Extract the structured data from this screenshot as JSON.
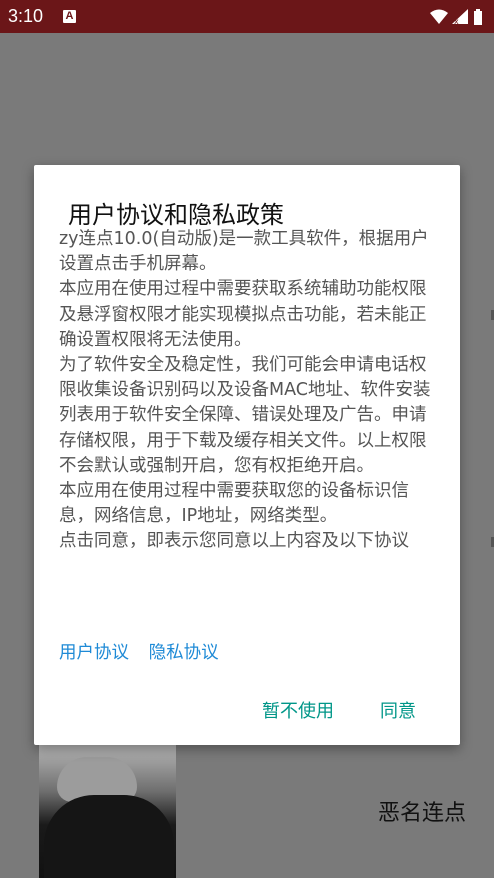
{
  "status_bar": {
    "time": "3:10",
    "app_icon_letter": "A"
  },
  "background": {
    "app_name": "恶名连点"
  },
  "dialog": {
    "title": "用户协议和隐私政策",
    "paragraphs": [
      "zy连点10.0(自动版)是一款工具软件，根据用户设置点击手机屏幕。",
      "本应用在使用过程中需要获取系统辅助功能权限及悬浮窗权限才能实现模拟点击功能，若未能正确设置权限将无法使用。",
      "为了软件安全及稳定性，我们可能会申请电话权限收集设备识别码以及设备MAC地址、软件安装列表用于软件安全保障、错误处理及广告。申请存储权限，用于下载及缓存相关文件。以上权限不会默认或强制开启，您有权拒绝开启。",
      "本应用在使用过程中需要获取您的设备标识信息，网络信息，IP地址，网络类型。",
      "点击同意，即表示您同意以上内容及以下协议"
    ],
    "link_user_agreement": "用户协议",
    "link_privacy_policy": "隐私协议",
    "button_decline": "暂不使用",
    "button_agree": "同意"
  },
  "colors": {
    "status_bar": "#6b1618",
    "link": "#1e8ad6",
    "button": "#009688",
    "body_text": "#555555"
  }
}
